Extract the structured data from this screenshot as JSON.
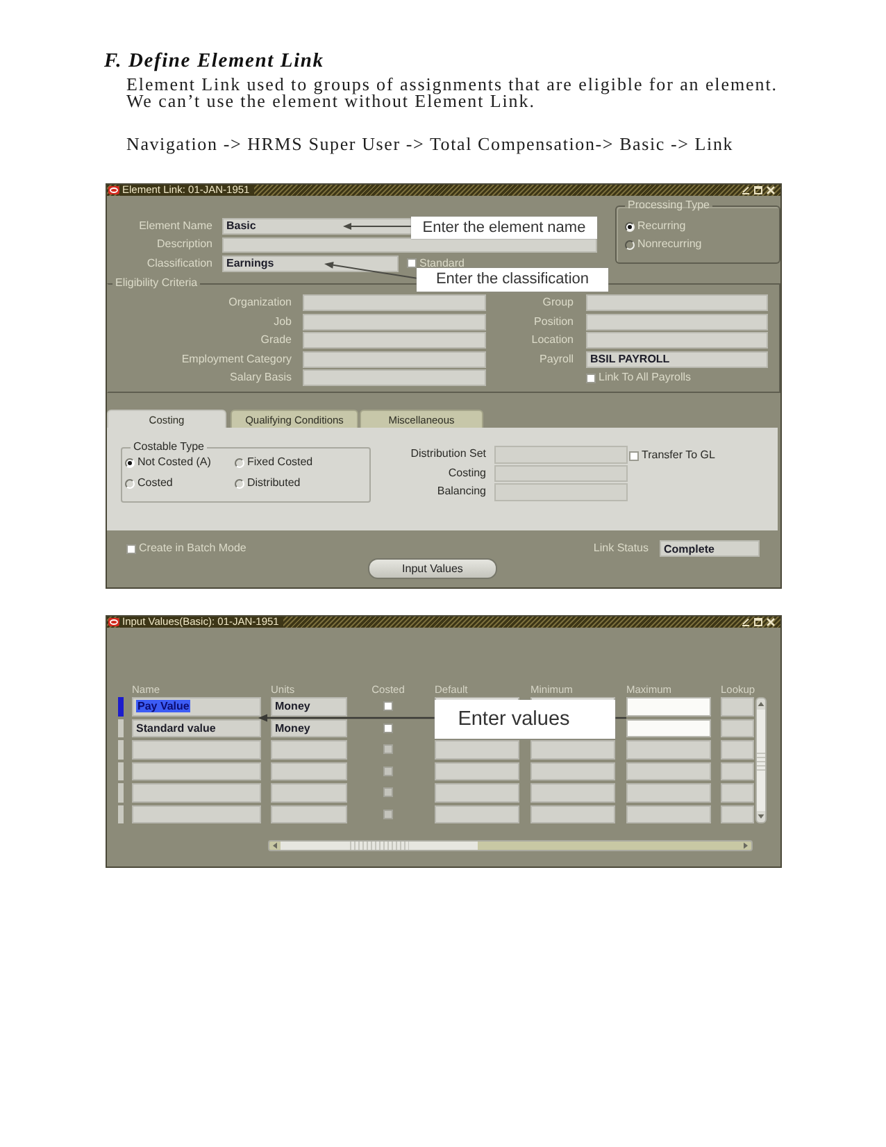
{
  "heading": "F. Define Element Link",
  "intro": "Element Link used to groups of assignments that are eligible for an element.\nWe can’t use the element without Element Link.",
  "navigation": "Navigation -> HRMS Super User -> Total Compensation-> Basic -> Link",
  "element_link_window": {
    "title": "Element Link: 01-JAN-1951",
    "fields": [
      {
        "label": "Element Name",
        "value": "Basic"
      },
      {
        "label": "Description"
      },
      {
        "label": "Classification",
        "value": "Earnings",
        "checkbox": {
          "label": "Standard",
          "checked": false
        }
      }
    ],
    "processing_type": {
      "title": "Processing Type",
      "options": [
        {
          "label": "Recurring",
          "selected": true
        },
        {
          "label": "Nonrecurring",
          "selected": false
        }
      ]
    },
    "eligibility_criteria": {
      "title": "Eligibility Criteria",
      "left_fields": [
        {
          "label": "Organization"
        },
        {
          "label": "Job"
        },
        {
          "label": "Grade"
        },
        {
          "label": "Employment Category"
        },
        {
          "label": "Salary Basis"
        }
      ],
      "right_fields": [
        {
          "label": "Group"
        },
        {
          "label": "Position"
        },
        {
          "label": "Location"
        },
        {
          "label": "Payroll",
          "value": "BSIL PAYROLL"
        }
      ],
      "link_to_all_payrolls": {
        "label": "Link To All Payrolls",
        "checked": false
      }
    },
    "tabs": [
      {
        "label": "Costing",
        "selected": true
      },
      {
        "label": "Qualifying Conditions",
        "selected": false
      },
      {
        "label": "Miscellaneous",
        "selected": false
      }
    ],
    "costing": {
      "costable_type": {
        "title": "Costable Type",
        "options": [
          {
            "label": "Not Costed (A)",
            "selected": true
          },
          {
            "label": "Fixed Costed",
            "selected": false
          },
          {
            "label": "Costed",
            "selected": false
          },
          {
            "label": "Distributed",
            "selected": false
          }
        ]
      },
      "fields": [
        {
          "label": "Distribution Set"
        },
        {
          "label": "Costing"
        },
        {
          "label": "Balancing"
        }
      ],
      "transfer_to_gl": {
        "label": "Transfer To GL",
        "checked": false
      }
    },
    "create_in_batch_mode": {
      "label": "Create in Batch Mode",
      "checked": false
    },
    "link_status": {
      "label": "Link Status",
      "value": "Complete"
    },
    "input_values_button": "Input Values",
    "callouts": [
      {
        "text": "Enter the element name"
      },
      {
        "text": "Enter the classification"
      }
    ]
  },
  "input_values_window": {
    "title": "Input Values(Basic): 01-JAN-1951",
    "columns": [
      "Name",
      "Units",
      "Costed",
      "Default",
      "Minimum",
      "Maximum",
      "Lookup"
    ],
    "rows": [
      {
        "name": "Pay Value",
        "units": "Money",
        "costed": false,
        "disabled": false,
        "selected": true
      },
      {
        "name": "Standard value",
        "units": "Money",
        "costed": false,
        "disabled": false,
        "selected": false
      },
      {
        "costed": false,
        "disabled": true,
        "selected": false
      },
      {
        "costed": false,
        "disabled": true,
        "selected": false
      },
      {
        "costed": false,
        "disabled": true,
        "selected": false
      },
      {
        "costed": false,
        "disabled": true,
        "selected": false
      }
    ],
    "callouts": [
      {
        "text": "Enter values"
      }
    ]
  }
}
